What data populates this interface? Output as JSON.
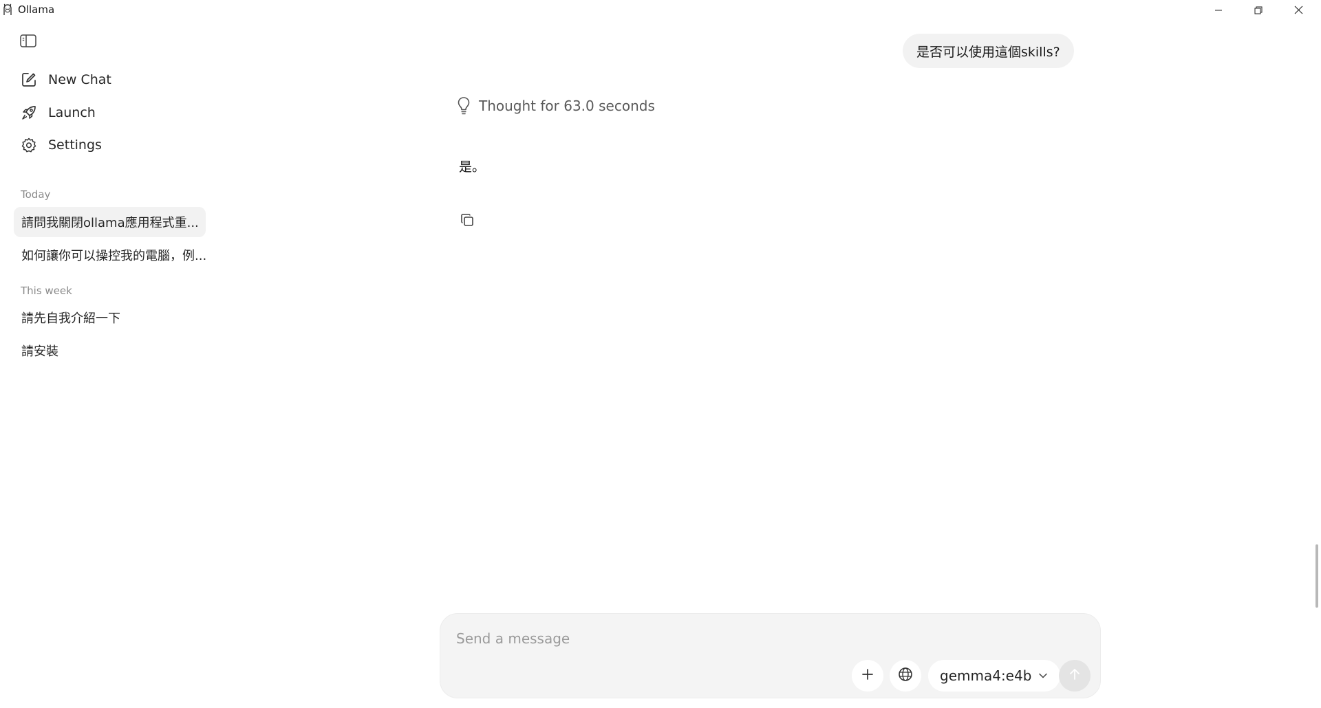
{
  "window": {
    "title": "Ollama",
    "controls": [
      "minimize-icon",
      "restore-icon",
      "close-icon"
    ]
  },
  "sidebar": {
    "toggle_icon": "sidebar-panel-icon",
    "nav": [
      {
        "label": "New Chat",
        "icon": "edit-square-icon"
      },
      {
        "label": "Launch",
        "icon": "rocket-icon"
      },
      {
        "label": "Settings",
        "icon": "gear-icon"
      }
    ],
    "sections": [
      {
        "title": "Today",
        "items": [
          {
            "label": "請問我關閉ollama應用程式重...",
            "active": true
          },
          {
            "label": "如何讓你可以操控我的電腦，例...",
            "active": false
          }
        ]
      },
      {
        "title": "This week",
        "items": [
          {
            "label": "請先自我介紹一下",
            "active": false
          },
          {
            "label": "請安裝",
            "active": false
          }
        ]
      }
    ]
  },
  "chat": {
    "user_message": "是否可以使用這個skills?",
    "thought_label": "Thought for 63.0 seconds",
    "assistant_message": "是。",
    "copy_icon": "copy-icon"
  },
  "composer": {
    "placeholder": "Send a message",
    "value": "",
    "attach_icon": "plus-icon",
    "web_icon": "globe-icon",
    "model": "gemma4:e4b",
    "send_icon": "arrow-up-icon"
  },
  "colors": {
    "background": "#ffffff",
    "bubble": "#f2f2f2",
    "composer": "#f4f4f4",
    "muted_text": "#8a8a8a",
    "send_disabled": "#e4e4e4"
  }
}
